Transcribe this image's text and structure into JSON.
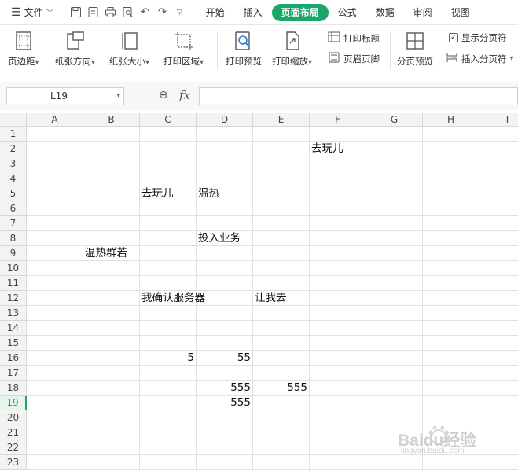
{
  "menu": {
    "file_label": "文件",
    "tabs": [
      {
        "label": "开始",
        "active": false
      },
      {
        "label": "插入",
        "active": false
      },
      {
        "label": "页面布局",
        "active": true
      },
      {
        "label": "公式",
        "active": false
      },
      {
        "label": "数据",
        "active": false
      },
      {
        "label": "审阅",
        "active": false
      },
      {
        "label": "视图",
        "active": false
      }
    ],
    "accent_color": "#1aa86a"
  },
  "ribbon": {
    "margins": "页边距",
    "orientation": "纸张方向",
    "paper_size": "纸张大小",
    "print_area": "打印区域",
    "print_preview": "打印预览",
    "print_scale": "打印缩放",
    "print_titles": "打印标题",
    "header_footer": "页眉页脚",
    "page_break_preview": "分页预览",
    "show_page_breaks": "显示分页符",
    "insert_page_break": "插入分页符"
  },
  "formula_bar": {
    "cell_ref": "L19",
    "fx": "fx",
    "value": ""
  },
  "sheet": {
    "columns": [
      "A",
      "B",
      "C",
      "D",
      "E",
      "F",
      "G",
      "H",
      "I"
    ],
    "rows": [
      "1",
      "2",
      "3",
      "4",
      "5",
      "6",
      "7",
      "8",
      "9",
      "10",
      "11",
      "12",
      "13",
      "14",
      "15",
      "16",
      "17",
      "18",
      "19",
      "20",
      "21",
      "22",
      "23"
    ],
    "selected_row": "19",
    "cells": {
      "F2": "去玩儿",
      "C5": "去玩儿",
      "D5": "温热",
      "D8": "投入业务",
      "B9": "温热群若",
      "C12": "我确认服务器",
      "E12": "让我去",
      "C16": "5",
      "D16": "55",
      "D18": "555",
      "E18": "555",
      "D19": "555"
    }
  },
  "watermark": {
    "text": "Baidu经验",
    "url": "jingyan.baidu.com"
  }
}
